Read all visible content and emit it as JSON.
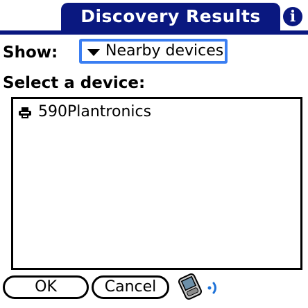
{
  "titlebar": {
    "title": "Discovery Results",
    "info_glyph": "i"
  },
  "show_row": {
    "label": "Show:",
    "selected_value": "Nearby devices"
  },
  "list_section": {
    "label": "Select a device:",
    "items": [
      {
        "label": "590Plantronics",
        "icon": "printer-icon"
      }
    ]
  },
  "buttons": {
    "ok_label": "OK",
    "cancel_label": "Cancel"
  },
  "icons": {
    "info": "info-icon",
    "dropdown": "triangle-down-icon",
    "device": "printer-icon",
    "discovery": "handheld-bluetooth-icon"
  },
  "colors": {
    "title_bar": "#0a1880",
    "focus_ring": "#3a7ef2",
    "text": "#000000",
    "background": "#ffffff"
  }
}
